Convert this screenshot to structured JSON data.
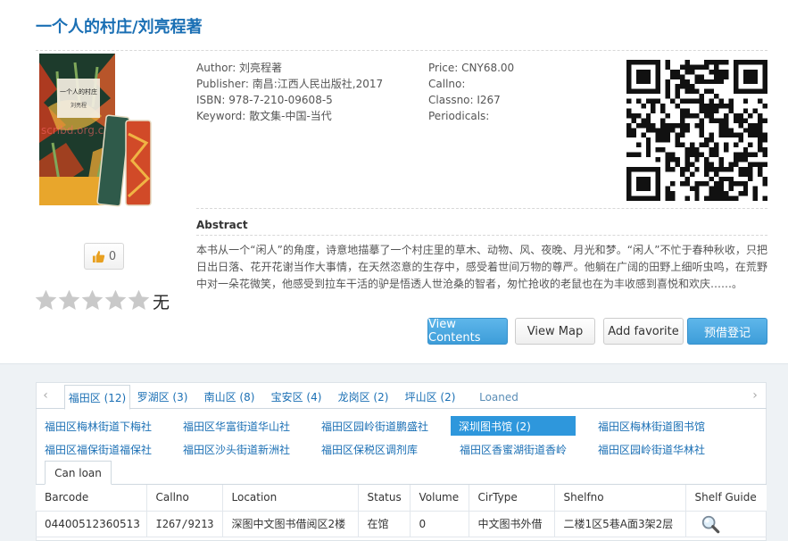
{
  "book": {
    "title": "一个人的村庄/刘亮程著",
    "likes": "0",
    "rating_text": "无",
    "cover_watermark": "scribd.org.cn",
    "cover_title": "一个人的村庄",
    "cover_author": "刘亮程",
    "rating_stars": 0
  },
  "meta": {
    "author": "Author: 刘亮程著",
    "publisher": "Publisher: 南昌:江西人民出版社,2017",
    "isbn": "ISBN: 978-7-210-09608-5",
    "keyword": "Keyword: 散文集-中国-当代",
    "price": "Price: CNY68.00",
    "callno": "Callno:",
    "classno": "Classno: I267",
    "periodicals": "Periodicals:"
  },
  "abstract": {
    "heading": "Abstract",
    "text": "本书从一个“闲人”的角度，诗意地描摹了一个村庄里的草木、动物、风、夜晚、月光和梦。“闲人”不忙于春种秋收，只把日出日落、花开花谢当作大事情，在天然恣意的生存中，感受着世间万物的尊严。他躺在广阔的田野上细听虫鸣，在荒野中对一朵花微笑，他感受到拉车干活的驴是悟透人世沧桑的智者，匆忙抢收的老鼠也在为丰收感到喜悦和欢庆……。"
  },
  "actions": {
    "view_contents": "View Contents",
    "view_map": "View Map",
    "add_favorite": "Add favorite",
    "reserve": "预借登记"
  },
  "district_tabs": [
    "福田区 (12)",
    "罗湖区 (3)",
    "南山区 (8)",
    "宝安区 (4)",
    "龙岗区 (2)",
    "坪山区 (2)",
    "Loaned"
  ],
  "libraries": [
    "福田区梅林街道下梅社",
    "福田区华富街道华山社",
    "福田区园岭街道鹏盛社",
    "深圳图书馆 (2)",
    "福田区梅林街道图书馆",
    "福田区福保街道福保社",
    "福田区沙头街道新洲社",
    "福田区保税区调剂库",
    "福田区香蜜湖街道香岭",
    "福田区园岭街道华林社"
  ],
  "subtab": "Can loan",
  "holdings": {
    "headers": [
      "Barcode",
      "Callno",
      "Location",
      "Status",
      "Volume",
      "CirType",
      "Shelfno",
      "Shelf Guide"
    ],
    "rows": [
      [
        "04400512360513",
        "I267/9213",
        "深图中文图书借阅区2楼",
        "在馆",
        "0",
        "中文图书外借",
        "二楼1区5巷A面3架2层"
      ]
    ]
  },
  "colors": {
    "accent": "#1a6fb4",
    "button_blue": "#3d9dd9",
    "selected_library": "#2e97dc",
    "lower_bg": "#eef2f5"
  }
}
